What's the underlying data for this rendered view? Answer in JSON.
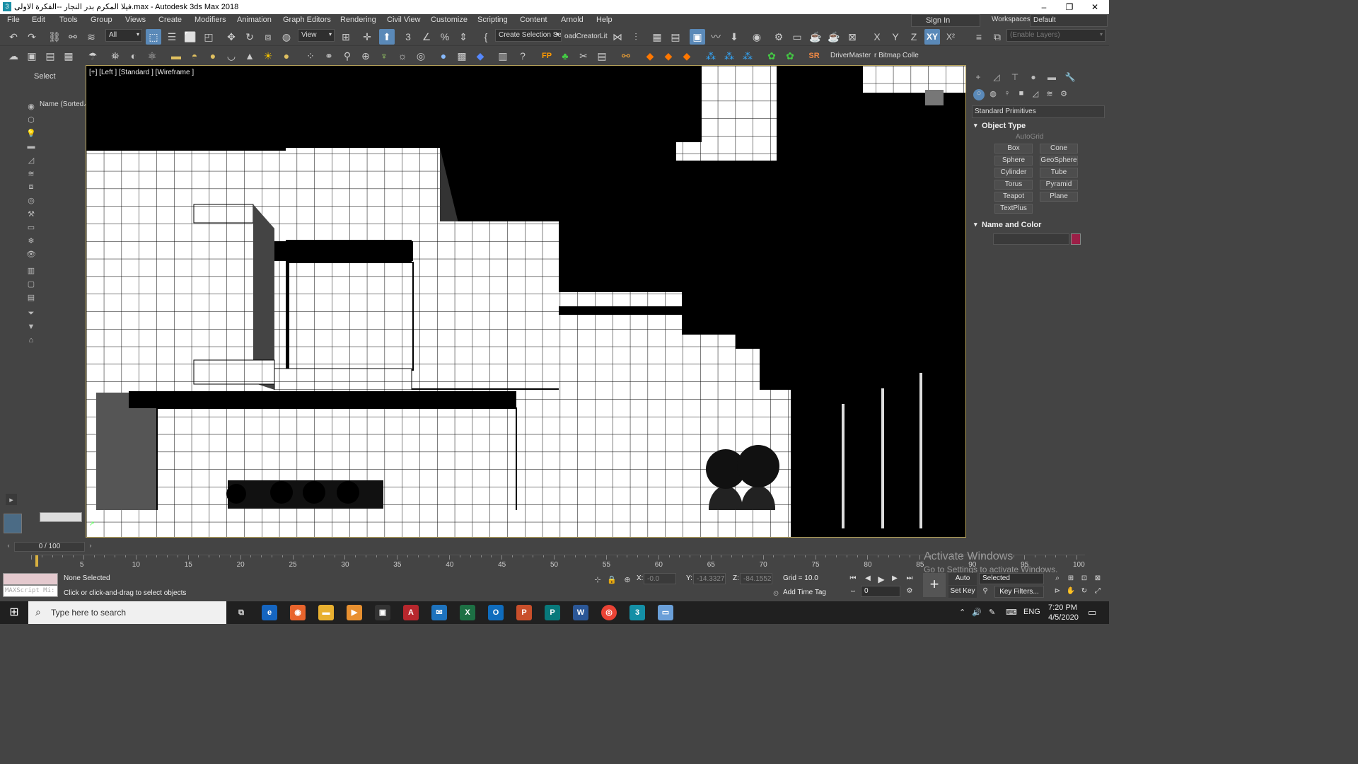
{
  "window": {
    "title": "فيلا المكرم بدر النجار --الفكرة الاولى.max - Autodesk 3ds Max 2018",
    "minimize": "–",
    "restore": "❐",
    "close": "✕"
  },
  "menu": [
    "File",
    "Edit",
    "Tools",
    "Group",
    "Views",
    "Create",
    "Modifiers",
    "Animation",
    "Graph Editors",
    "Rendering",
    "Civil View",
    "Customize",
    "Scripting",
    "Content",
    "Arnold",
    "Help"
  ],
  "signin": "Sign In",
  "workspaces": {
    "label": "Workspaces:",
    "value": "Default"
  },
  "toolbar1": {
    "filter": "All",
    "refcoord": "View",
    "create_sel_set": "Create Selection Se",
    "loader": "oadCreatorLit",
    "enable_layers": "(Enable Layers)",
    "axis_x": "X",
    "axis_y": "Y",
    "axis_z": "Z",
    "axis_xy": "XY",
    "axis_xy2": "X²"
  },
  "toolbar2": {
    "fp": "FP",
    "sr": "SR",
    "drivermaster": "DriverMaster",
    "bitmap": "r Bitmap Colle"
  },
  "left": {
    "select": "Select",
    "name_sorted": "Name (Sorted ⁄"
  },
  "viewport": {
    "label": "[+] [Left ] [Standard ] [Wireframe ]"
  },
  "command_panel": {
    "dropdown": "Standard Primitives",
    "object_type": "Object Type",
    "autogrid": "AutoGrid",
    "primitives": [
      "Box",
      "Cone",
      "Sphere",
      "GeoSphere",
      "Cylinder",
      "Tube",
      "Torus",
      "Pyramid",
      "Teapot",
      "Plane",
      "TextPlus"
    ],
    "name_and_color": "Name and Color",
    "color": "#9c1f47"
  },
  "timeline": {
    "slider": "0 / 100",
    "ticks": [
      "5",
      "10",
      "15",
      "20",
      "25",
      "30",
      "35",
      "40",
      "45",
      "50",
      "55",
      "60",
      "65",
      "70",
      "75",
      "80",
      "85",
      "90",
      "95",
      "100"
    ]
  },
  "status": {
    "none_selected": "None Selected",
    "prompt": "Click or click-and-drag to select objects",
    "maxscript": "MAXScript Mi:",
    "x_label": "X:",
    "x_val": "-0.0",
    "y_label": "Y:",
    "y_val": "-14.3327",
    "z_label": "Z:",
    "z_val": "-84.1552",
    "grid": "Grid = 10.0",
    "add_time_tag": "Add Time Tag",
    "auto_key": "Auto Key",
    "set_key": "Set Key",
    "selected": "Selected",
    "key_filters": "Key Filters...",
    "frame": "0",
    "activate_title": "Activate Windows",
    "activate_sub": "Go to Settings to activate Windows."
  },
  "taskbar": {
    "search": "Type here to search",
    "lang": "ENG",
    "time": "7:20 PM",
    "date": "4/5/2020",
    "start": "⊞"
  }
}
